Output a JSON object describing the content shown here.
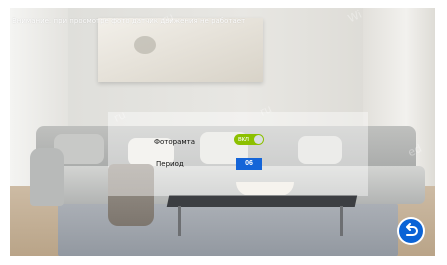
{
  "notice": {
    "text": "Внимание: при просмотре фото датчик движения не работает"
  },
  "settings": {
    "slideshow_label": "Фоторамта",
    "slideshow_toggle_text": "вкл",
    "slideshow_enabled": true,
    "period_label": "Период",
    "period_value": "06"
  },
  "watermarks": [
    "ru",
    "ru",
    "ru",
    "Wi",
    "ed"
  ],
  "icons": {
    "back": "back-arrow-icon"
  },
  "colors": {
    "toggle_on": "#8cc000",
    "period_bg": "#1565d8",
    "back_button": "#0a63d6"
  }
}
